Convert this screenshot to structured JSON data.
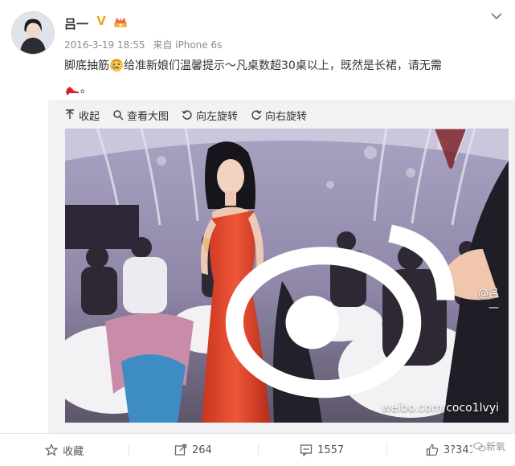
{
  "post": {
    "username": "吕一",
    "vip_badge": "V",
    "timestamp": "2016-3-19 18:55",
    "source": "来自 iPhone 6s",
    "text_part1": "脚底抽筋",
    "text_part2": "给准新娘们温馨提示～凡桌数超30桌以上，既然是长裙，请无需",
    "text_part3": "。"
  },
  "media_toolbar": {
    "collapse": "收起",
    "view_large": "查看大图",
    "rotate_left": "向左旋转",
    "rotate_right": "向右旋转"
  },
  "watermark": {
    "handle": "@吕一",
    "url": "weibo.com/coco1lvyi"
  },
  "actions": {
    "favorite": "收藏",
    "repost_count": "264",
    "comment_count": "1557",
    "like_count": "3?341"
  },
  "corner_mark": "新氧",
  "colors": {
    "accent": "#f5a623",
    "dress": "#e5432a",
    "muted": "#8c8c8c"
  }
}
